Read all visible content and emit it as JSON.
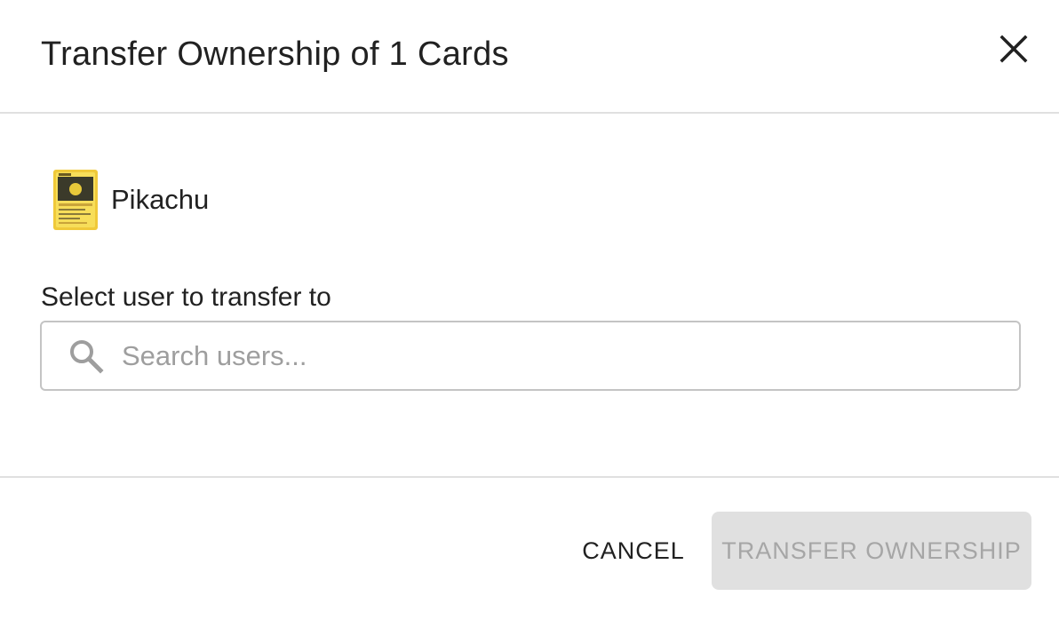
{
  "dialog": {
    "title": "Transfer Ownership of 1 Cards",
    "close_icon": "close-icon"
  },
  "card": {
    "name": "Pikachu",
    "thumbnail_icon": "card-thumbnail",
    "thumbnail_colors": {
      "border": "#f0c93a",
      "art": "#3b3a2a",
      "accent": "#f5e26b"
    }
  },
  "transfer_field": {
    "label": "Select user to transfer to",
    "search_placeholder": "Search users...",
    "search_value": "",
    "icon": "search-icon"
  },
  "actions": {
    "cancel_label": "CANCEL",
    "transfer_label": "TRANSFER OWNERSHIP",
    "transfer_disabled": true
  },
  "colors": {
    "divider": "#e0e0e0",
    "text_primary": "#212121",
    "placeholder": "#9e9e9e",
    "disabled_bg": "#e0e0e0",
    "disabled_text": "#a6a6a6"
  }
}
